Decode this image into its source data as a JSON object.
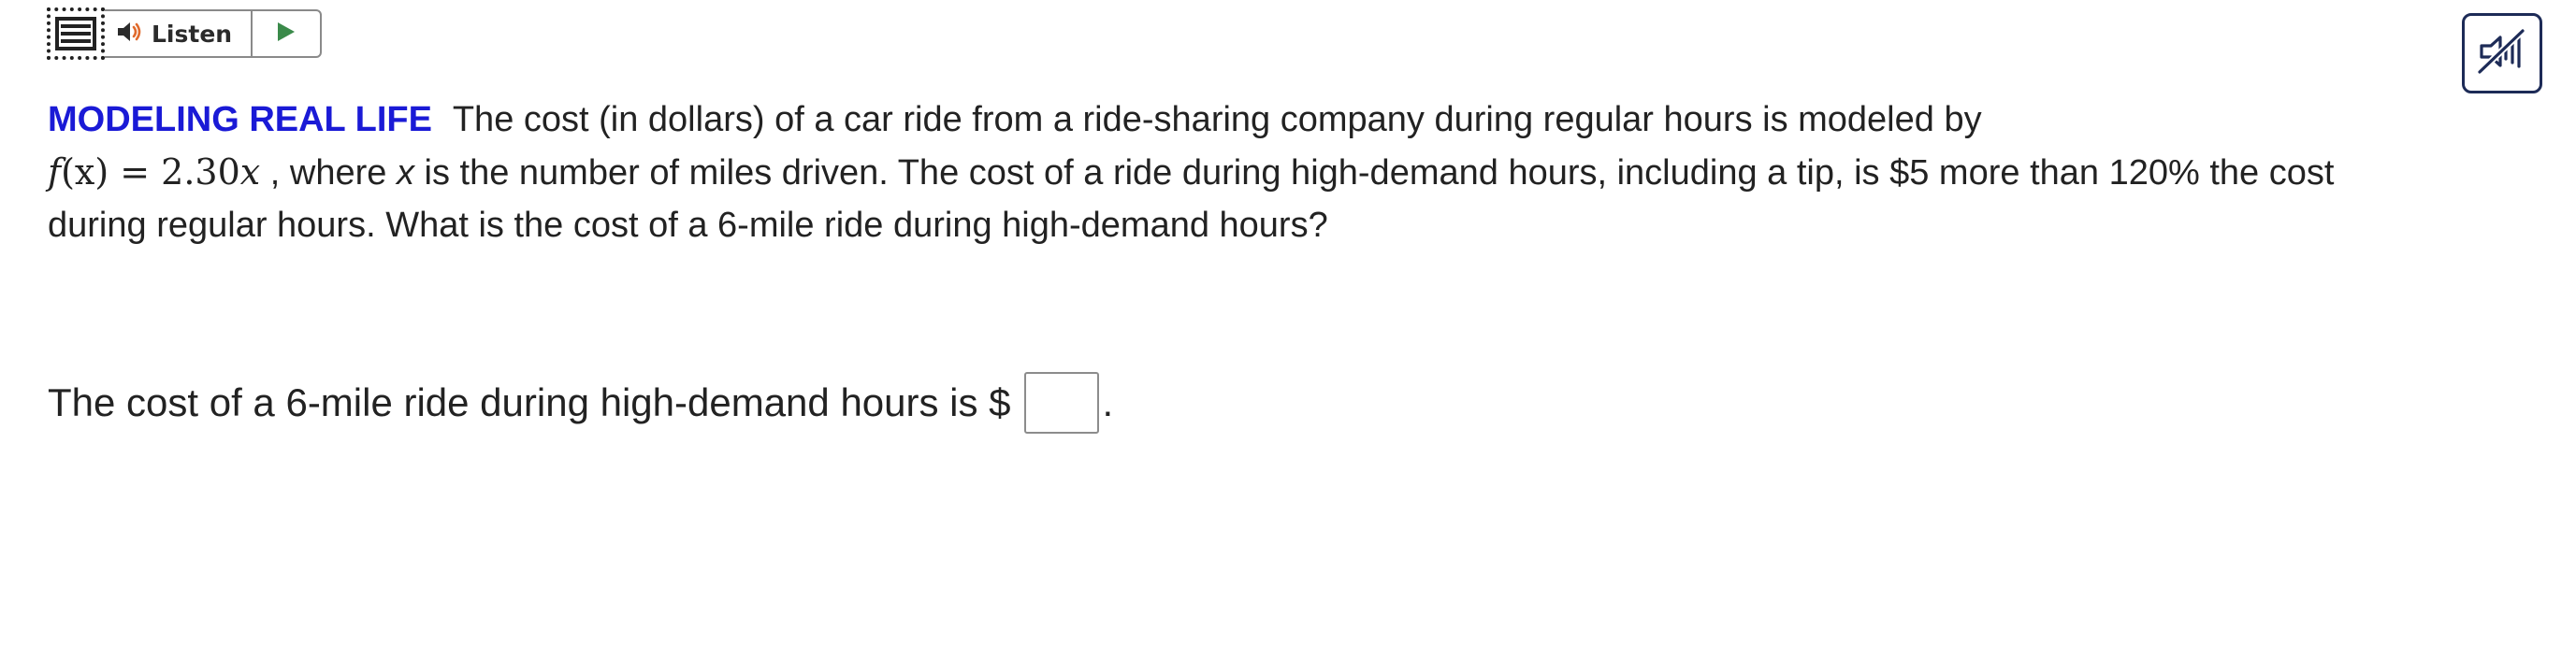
{
  "toolbar": {
    "listen_label": "Listen",
    "menu_icon": "hamburger-menu-icon",
    "speaker_icon": "speaker-icon",
    "play_icon": "play-icon",
    "play_color": "#3a8a4a"
  },
  "audio_toggle": {
    "icon": "muted-speaker-icon",
    "color": "#1d2b57"
  },
  "problem": {
    "tag": "MODELING REAL LIFE",
    "text_1": "The cost (in dollars) of a car ride from a ride-sharing company during regular hours is modeled by",
    "formula_lhs": "f",
    "formula_paren": "(x)",
    "formula_eq": " = 2.30",
    "formula_var": "x",
    "text_2": ", where",
    "text_var": "x",
    "text_3": "is the number of miles driven. The cost of a ride during high-demand hours, including a tip, is $5 more than 120% the cost during regular hours. What is the cost of a 6-mile ride during high-demand hours?",
    "tag_color": "#1a1ad6"
  },
  "answer": {
    "prompt": "The cost of a 6-mile ride during high-demand hours is $",
    "value": "",
    "suffix": "."
  }
}
